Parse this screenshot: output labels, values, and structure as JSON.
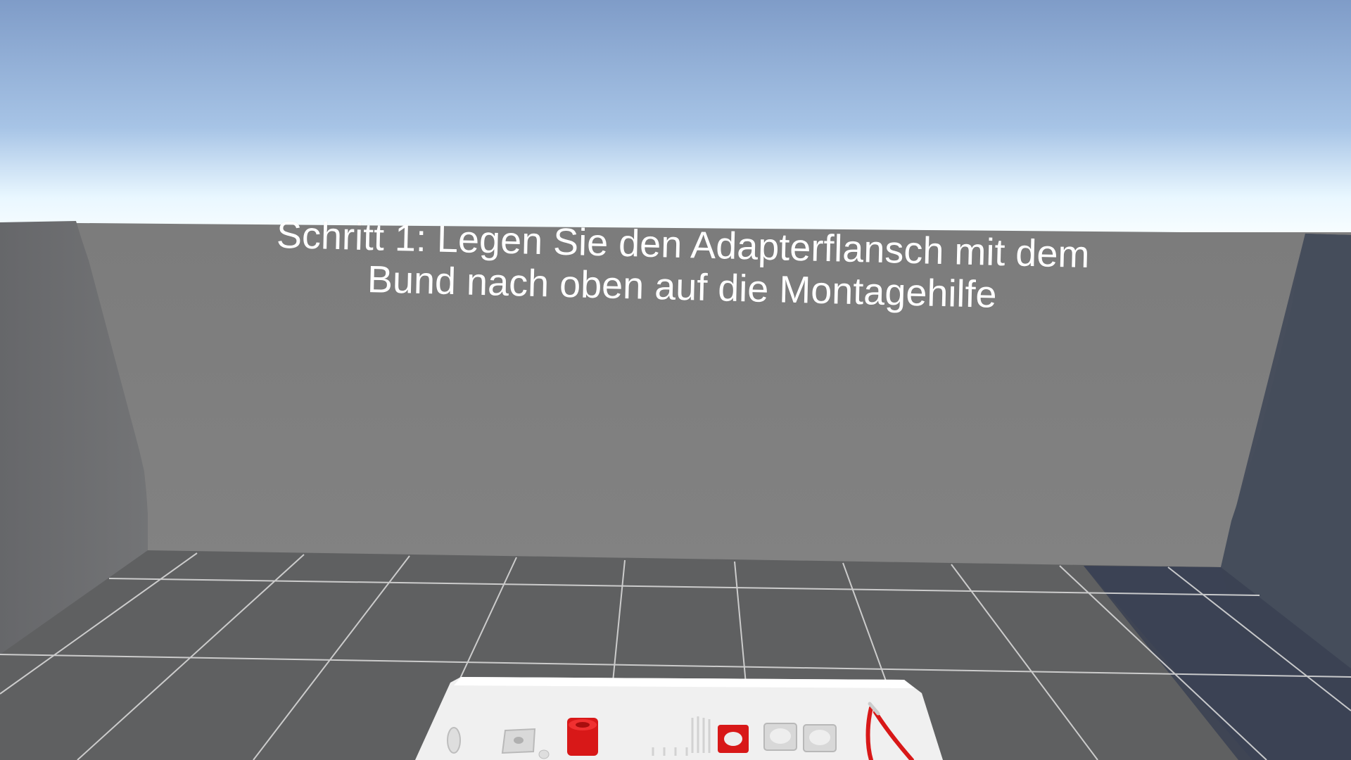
{
  "instruction": {
    "line1": "Schritt 1: Legen Sie den Adapterflansch mit dem",
    "line2": "Bund nach oben auf die Montagehilfe"
  },
  "colors": {
    "sky_top": "#7f9cc8",
    "sky_horizon": "#f2fbff",
    "back_wall": "#808080",
    "left_wall": "#6b6c6e",
    "right_wall_shadow": "#474e5c",
    "floor": "#5f6061",
    "floor_grid": "#d8d8d8",
    "table": "#f0f0f0",
    "part_red": "#d81818",
    "part_light": "#dedede"
  },
  "scene_objects": {
    "table": "assembly-table",
    "parts": [
      "screw-part",
      "square-plate-part",
      "red-flange-part",
      "pin-rack-part",
      "red-ring-part",
      "white-ring-part-1",
      "white-ring-part-2",
      "pliers-tool"
    ]
  }
}
